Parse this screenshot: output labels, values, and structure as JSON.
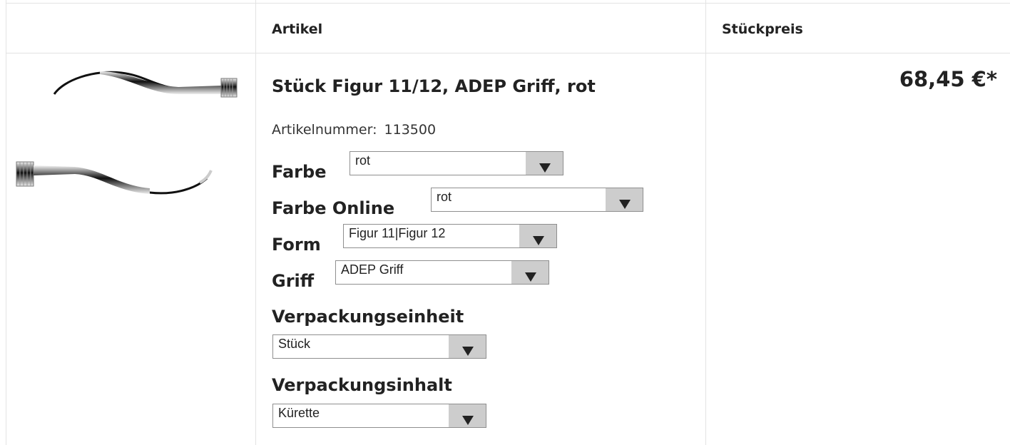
{
  "header": {
    "col_article": "Artikel",
    "col_unit_price": "Stückpreis"
  },
  "product": {
    "title": "Stück Figur 11/12, ADEP Griff, rot",
    "article_number_label": "Artikelnummer:",
    "article_number": "113500",
    "price": "68,45 €*",
    "image_icon": "dental-curette-instrument-image"
  },
  "options": {
    "farbe": {
      "label": "Farbe",
      "value": "rot"
    },
    "farbe_online": {
      "label": "Farbe Online",
      "value": "rot"
    },
    "form": {
      "label": "Form",
      "value": "Figur 11|Figur 12"
    },
    "griff": {
      "label": "Griff",
      "value": "ADEP Griff"
    },
    "verpackungseinheit": {
      "label": "Verpackungseinheit",
      "value": "Stück"
    },
    "verpackungsinhalt": {
      "label": "Verpackungsinhalt",
      "value": "Kürette"
    }
  },
  "colors": {
    "border": "#e3e3e3",
    "select_arrow_bg": "#cdcdcd",
    "text": "#222222"
  }
}
